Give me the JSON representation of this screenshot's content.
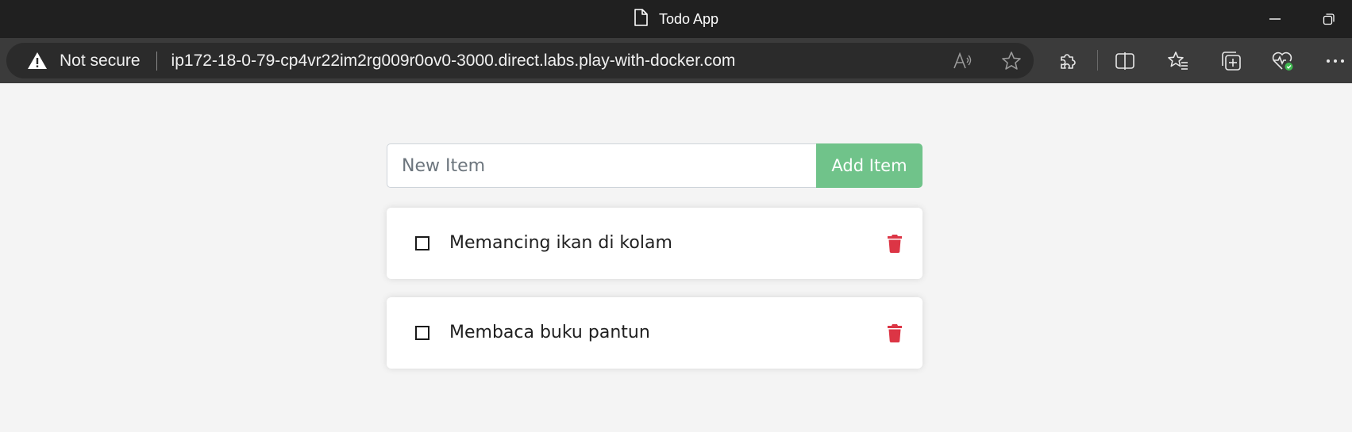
{
  "window": {
    "title": "Todo App",
    "title_icon": "document-icon"
  },
  "address_bar": {
    "security_label": "Not secure",
    "url": "ip172-18-0-79-cp4vr22im2rg009r0ov0-3000.direct.labs.play-with-docker.com"
  },
  "toolbar_icons": [
    "read-aloud-icon",
    "favorite-star-icon",
    "extensions-icon",
    "split-screen-icon",
    "favorites-icon",
    "collections-icon",
    "browser-essentials-icon",
    "more-icon"
  ],
  "app": {
    "new_item_placeholder": "New Item",
    "new_item_value": "",
    "add_button_label": "Add Item",
    "accent_color": "#70c38a",
    "delete_color": "#dc3545",
    "items": [
      {
        "name": "Memancing ikan di kolam",
        "completed": false
      },
      {
        "name": "Membaca buku pantun",
        "completed": false
      }
    ]
  }
}
